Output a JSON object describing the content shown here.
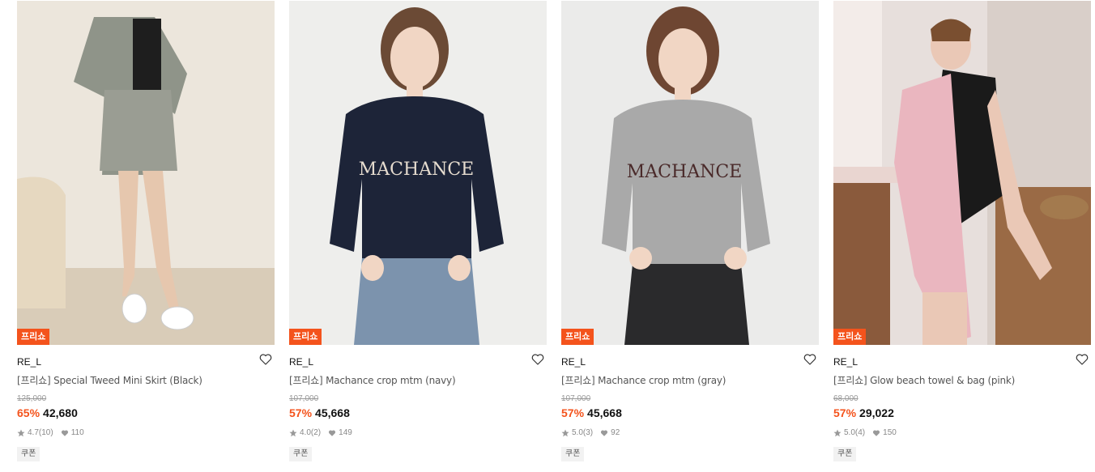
{
  "products": [
    {
      "badge": "프리쇼",
      "brand": "RE_L",
      "title": "[프리쇼] Special Tweed Mini Skirt (Black)",
      "original_price": "125,000",
      "discount": "65%",
      "price": "42,680",
      "rating": "4.7",
      "reviews": "(10)",
      "likes": "110",
      "coupon": "쿠폰"
    },
    {
      "badge": "프리쇼",
      "brand": "RE_L",
      "title": "[프리쇼] Machance crop mtm (navy)",
      "original_price": "107,000",
      "discount": "57%",
      "price": "45,668",
      "rating": "4.0",
      "reviews": "(2)",
      "likes": "149",
      "coupon": "쿠폰"
    },
    {
      "badge": "프리쇼",
      "brand": "RE_L",
      "title": "[프리쇼] Machance crop mtm (gray)",
      "original_price": "107,000",
      "discount": "57%",
      "price": "45,668",
      "rating": "5.0",
      "reviews": "(3)",
      "likes": "92",
      "coupon": "쿠폰"
    },
    {
      "badge": "프리쇼",
      "brand": "RE_L",
      "title": "[프리쇼] Glow beach towel & bag (pink)",
      "original_price": "68,000",
      "discount": "57%",
      "price": "29,022",
      "rating": "5.0",
      "reviews": "(4)",
      "likes": "150",
      "coupon": "쿠폰"
    }
  ],
  "colors": {
    "accent": "#f4531c",
    "muted": "#888888"
  }
}
